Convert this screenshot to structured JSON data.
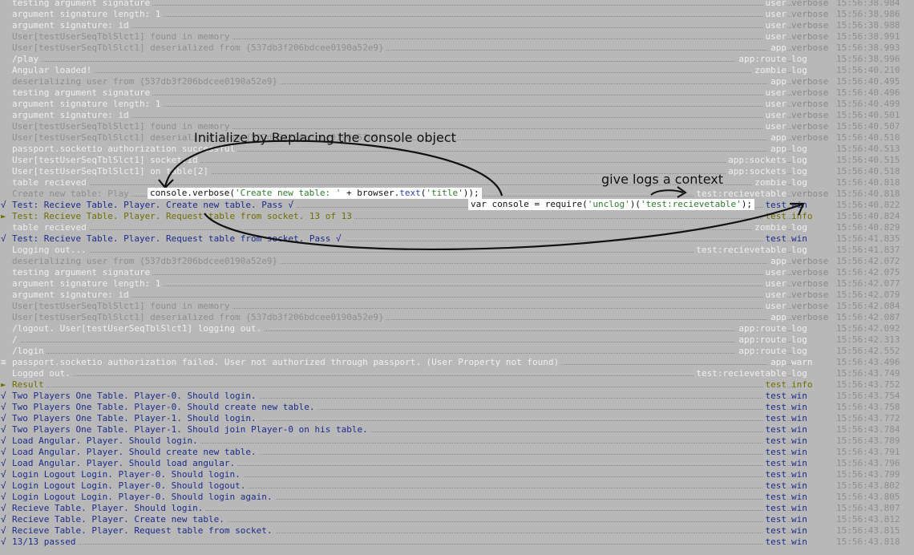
{
  "log_rows": [
    {
      "marker": "",
      "msg": "testing argument signature",
      "msg_color": "white",
      "ctx": "user",
      "ctx_color": "white",
      "level": "verbose",
      "ts": "15:56:38.984"
    },
    {
      "marker": "",
      "msg": "argument signature length: 1",
      "msg_color": "white",
      "ctx": "user",
      "ctx_color": "white",
      "level": "verbose",
      "ts": "15:56:38.986"
    },
    {
      "marker": "",
      "msg": "argument signature: id",
      "msg_color": "white",
      "ctx": "user",
      "ctx_color": "white",
      "level": "verbose",
      "ts": "15:56:38.988"
    },
    {
      "marker": "",
      "msg": "User[testUserSeqTblSlct1] found in memory",
      "msg_color": "grey",
      "ctx": "user",
      "ctx_color": "white",
      "level": "verbose",
      "ts": "15:56:38.991"
    },
    {
      "marker": "",
      "msg": "User[testUserSeqTblSlct1] deserialized from {537db3f206bdcee0190a52e9}",
      "msg_color": "grey",
      "ctx": "app",
      "ctx_color": "white",
      "level": "verbose",
      "ts": "15:56:38.993"
    },
    {
      "marker": "",
      "msg": "/play",
      "msg_color": "white",
      "ctx": "app:route",
      "ctx_color": "white",
      "level": "log",
      "ts": "15:56:38.996"
    },
    {
      "marker": "",
      "msg": "Angular loaded!",
      "msg_color": "white",
      "ctx": "zombie",
      "ctx_color": "white",
      "level": "log",
      "ts": "15:56:40.210"
    },
    {
      "marker": "",
      "msg": "deserializing user from {537db3f206bdcee0190a52e9}",
      "msg_color": "grey",
      "ctx": "app",
      "ctx_color": "white",
      "level": "verbose",
      "ts": "15:56:40.495"
    },
    {
      "marker": "",
      "msg": "testing argument signature",
      "msg_color": "white",
      "ctx": "user",
      "ctx_color": "white",
      "level": "verbose",
      "ts": "15:56:40.496"
    },
    {
      "marker": "",
      "msg": "argument signature length: 1",
      "msg_color": "white",
      "ctx": "user",
      "ctx_color": "white",
      "level": "verbose",
      "ts": "15:56:40.499"
    },
    {
      "marker": "",
      "msg": "argument signature: id",
      "msg_color": "white",
      "ctx": "user",
      "ctx_color": "white",
      "level": "verbose",
      "ts": "15:56:40.501"
    },
    {
      "marker": "",
      "msg": "User[testUserSeqTblSlct1] found in memory",
      "msg_color": "grey",
      "ctx": "user",
      "ctx_color": "white",
      "level": "verbose",
      "ts": "15:56:40.507"
    },
    {
      "marker": "",
      "msg": "User[testUserSeqTblSlct1] deserialized from {537db3f206bdcee0190a52e9}",
      "msg_color": "grey",
      "ctx": "app",
      "ctx_color": "white",
      "level": "verbose",
      "ts": "15:56:40.510"
    },
    {
      "marker": "",
      "msg": "passport.socketio authorization successful",
      "msg_color": "white",
      "ctx": "app",
      "ctx_color": "white",
      "level": "log",
      "ts": "15:56:40.513"
    },
    {
      "marker": "",
      "msg": "User[testUserSeqTblSlct1] socket.id",
      "msg_color": "white",
      "ctx": "app:sockets",
      "ctx_color": "white",
      "level": "log",
      "ts": "15:56:40.515"
    },
    {
      "marker": "",
      "msg": "User[testUserSeqTblSlct1] on table[2]",
      "msg_color": "white",
      "ctx": "app:sockets",
      "ctx_color": "white",
      "level": "log",
      "ts": "15:56:40.518"
    },
    {
      "marker": "",
      "msg": "table recieved",
      "msg_color": "white",
      "ctx": "zombie",
      "ctx_color": "white",
      "level": "log",
      "ts": "15:56:40.818"
    },
    {
      "marker": "",
      "msg": "Create new table: Play",
      "msg_color": "grey",
      "ctx": "test:recievetable",
      "ctx_color": "white",
      "level": "verbose",
      "ts": "15:56:40.818"
    },
    {
      "marker": "√",
      "msg": "Test: Recieve Table. Player. Create new table.  Pass √",
      "msg_color": "navy",
      "ctx": "test",
      "ctx_color": "navy",
      "level": "win",
      "ts": "15:56:40.822"
    },
    {
      "marker": "►",
      "msg": "Test: Recieve Table. Player. Request table from socket.  13 of 13",
      "msg_color": "olive",
      "ctx": "test",
      "ctx_color": "olive",
      "level": "info",
      "ts": "15:56:40.824"
    },
    {
      "marker": "",
      "msg": "table recieved",
      "msg_color": "white",
      "ctx": "zombie",
      "ctx_color": "white",
      "level": "log",
      "ts": "15:56:40.829"
    },
    {
      "marker": "√",
      "msg": "Test: Recieve Table. Player. Request table from socket.  Pass √",
      "msg_color": "navy",
      "ctx": "test",
      "ctx_color": "navy",
      "level": "win",
      "ts": "15:56:41.835"
    },
    {
      "marker": "",
      "msg": "Logging out...",
      "msg_color": "white",
      "ctx": "test:recievetable",
      "ctx_color": "white",
      "level": "log",
      "ts": "15:56:41.837"
    },
    {
      "marker": "",
      "msg": "deserializing user from {537db3f206bdcee0190a52e9}",
      "msg_color": "grey",
      "ctx": "app",
      "ctx_color": "white",
      "level": "verbose",
      "ts": "15:56:42.072"
    },
    {
      "marker": "",
      "msg": "testing argument signature",
      "msg_color": "white",
      "ctx": "user",
      "ctx_color": "white",
      "level": "verbose",
      "ts": "15:56:42.075"
    },
    {
      "marker": "",
      "msg": "argument signature length: 1",
      "msg_color": "white",
      "ctx": "user",
      "ctx_color": "white",
      "level": "verbose",
      "ts": "15:56:42.077"
    },
    {
      "marker": "",
      "msg": "argument signature: id",
      "msg_color": "white",
      "ctx": "user",
      "ctx_color": "white",
      "level": "verbose",
      "ts": "15:56:42.079"
    },
    {
      "marker": "",
      "msg": "User[testUserSeqTblSlct1] found in memory",
      "msg_color": "grey",
      "ctx": "user",
      "ctx_color": "white",
      "level": "verbose",
      "ts": "15:56:42.084"
    },
    {
      "marker": "",
      "msg": "User[testUserSeqTblSlct1] deserialized from {537db3f206bdcee0190a52e9}",
      "msg_color": "grey",
      "ctx": "app",
      "ctx_color": "white",
      "level": "verbose",
      "ts": "15:56:42.087"
    },
    {
      "marker": "",
      "msg": "/logout. User[testUserSeqTblSlct1] logging out.",
      "msg_color": "white",
      "ctx": "app:route",
      "ctx_color": "white",
      "level": "log",
      "ts": "15:56:42.092"
    },
    {
      "marker": "",
      "msg": "/",
      "msg_color": "white",
      "ctx": "app:route",
      "ctx_color": "white",
      "level": "log",
      "ts": "15:56:42.313"
    },
    {
      "marker": "",
      "msg": "/login",
      "msg_color": "white",
      "ctx": "app:route",
      "ctx_color": "white",
      "level": "log",
      "ts": "15:56:42.552"
    },
    {
      "marker": "≡",
      "msg": "passport.socketio authorization failed. User not authorized through passport. (User Property not found)",
      "msg_color": "white",
      "ctx": "app",
      "ctx_color": "white",
      "level": "warn",
      "ts": "15:56:43.496"
    },
    {
      "marker": "",
      "msg": "Logged out.",
      "msg_color": "white",
      "ctx": "test:recievetable",
      "ctx_color": "white",
      "level": "log",
      "ts": "15:56:43.749"
    },
    {
      "marker": "►",
      "msg": "Result",
      "msg_color": "olive",
      "ctx": "test",
      "ctx_color": "olive",
      "level": "info",
      "ts": "15:56:43.752"
    },
    {
      "marker": "√",
      "msg": "Two Players One Table. Player-0. Should login.",
      "msg_color": "navy",
      "ctx": "test",
      "ctx_color": "navy",
      "level": "win",
      "ts": "15:56:43.754"
    },
    {
      "marker": "√",
      "msg": "Two Players One Table. Player-0. Should create new table.",
      "msg_color": "navy",
      "ctx": "test",
      "ctx_color": "navy",
      "level": "win",
      "ts": "15:56:43.758"
    },
    {
      "marker": "√",
      "msg": "Two Players One Table. Player-1. Should login.",
      "msg_color": "navy",
      "ctx": "test",
      "ctx_color": "navy",
      "level": "win",
      "ts": "15:56:43.772"
    },
    {
      "marker": "√",
      "msg": "Two Players One Table. Player-1. Should join Player-0 on his table.",
      "msg_color": "navy",
      "ctx": "test",
      "ctx_color": "navy",
      "level": "win",
      "ts": "15:56:43.784"
    },
    {
      "marker": "√",
      "msg": "Load Angular. Player. Should login.",
      "msg_color": "navy",
      "ctx": "test",
      "ctx_color": "navy",
      "level": "win",
      "ts": "15:56:43.789"
    },
    {
      "marker": "√",
      "msg": "Load Angular. Player. Should create new table.",
      "msg_color": "navy",
      "ctx": "test",
      "ctx_color": "navy",
      "level": "win",
      "ts": "15:56:43.791"
    },
    {
      "marker": "√",
      "msg": "Load Angular. Player. Should load angular.",
      "msg_color": "navy",
      "ctx": "test",
      "ctx_color": "navy",
      "level": "win",
      "ts": "15:56:43.796"
    },
    {
      "marker": "√",
      "msg": "Login Logout Login. Player-0. Should login.",
      "msg_color": "navy",
      "ctx": "test",
      "ctx_color": "navy",
      "level": "win",
      "ts": "15:56:43.799"
    },
    {
      "marker": "√",
      "msg": "Login Logout Login. Player-0. Should logout.",
      "msg_color": "navy",
      "ctx": "test",
      "ctx_color": "navy",
      "level": "win",
      "ts": "15:56:43.802"
    },
    {
      "marker": "√",
      "msg": "Login Logout Login. Player-0. Should login again.",
      "msg_color": "navy",
      "ctx": "test",
      "ctx_color": "navy",
      "level": "win",
      "ts": "15:56:43.805"
    },
    {
      "marker": "√",
      "msg": "Recieve Table. Player. Should login.",
      "msg_color": "navy",
      "ctx": "test",
      "ctx_color": "navy",
      "level": "win",
      "ts": "15:56:43.807"
    },
    {
      "marker": "√",
      "msg": "Recieve Table. Player. Create new table.",
      "msg_color": "navy",
      "ctx": "test",
      "ctx_color": "navy",
      "level": "win",
      "ts": "15:56:43.812"
    },
    {
      "marker": "√",
      "msg": "Recieve Table. Player. Request table from socket.",
      "msg_color": "navy",
      "ctx": "test",
      "ctx_color": "navy",
      "level": "win",
      "ts": "15:56:43.815"
    },
    {
      "marker": "√",
      "msg": "13/13 passed",
      "msg_color": "navy",
      "ctx": "test",
      "ctx_color": "navy",
      "level": "win",
      "ts": "15:56:43.818"
    }
  ],
  "annotations": {
    "init_label": "Initialize by Replacing the console object",
    "context_label": "give logs a context",
    "code_verbose": {
      "obj": "console",
      "dot_method": ".verbose(",
      "str": "'Create new table: '",
      "plus": " + browser.",
      "fn": "text",
      "open": "(",
      "str2": "'title'",
      "close": "));"
    },
    "code_require": {
      "kw": "var console = require(",
      "str": "'unclog'",
      "mid": ")(",
      "str2": "'test:recievetable'",
      "close": ");"
    }
  },
  "colors": {
    "background": "#b8b8b8",
    "white_text": "#efefef",
    "grey_text": "#8f8f8f",
    "win_navy": "#1c2c8c",
    "info_olive": "#6f6f00"
  }
}
